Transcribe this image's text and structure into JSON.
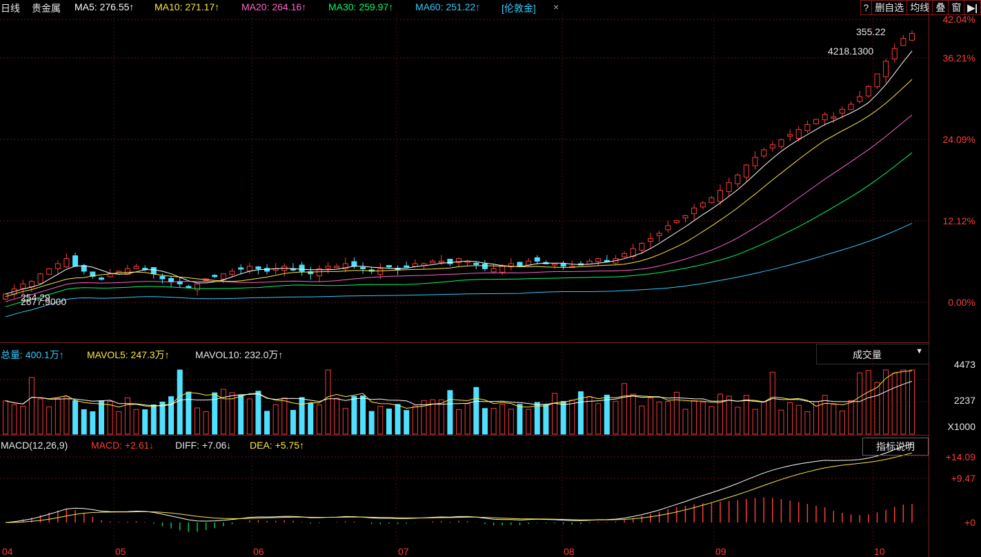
{
  "header": {
    "period": "日线",
    "name": "贵金属",
    "ma5": "MA5: 276.55↑",
    "ma10": "MA10: 271.17↑",
    "ma20": "MA20: 264.16↑",
    "ma30": "MA30: 259.97↑",
    "ma60": "MA60: 251.22↑",
    "overlay": "[伦敦金]",
    "close": "×"
  },
  "toolbar": [
    "?",
    "删自选",
    "均线",
    "叠",
    "窗"
  ],
  "toolbar_colors": {
    "border": "#8a1a1a"
  },
  "price_axis": [
    "42.04%",
    "36.21%",
    "24.09%",
    "12.12%",
    "0.00%"
  ],
  "annotations": {
    "high": "355.22",
    "overlay_value": "4218.1300",
    "low_a": "254.29",
    "low_b": "2677.9000"
  },
  "volume": {
    "total": "总量: 400.1万↑",
    "mavol5": "MAVOL5: 247.3万↑",
    "mavol10": "MAVOL10: 232.0万↑",
    "dropdown": "成交量",
    "axis": [
      "4473",
      "2237",
      "X1000"
    ]
  },
  "macd": {
    "title": "MACD(12,26,9)",
    "macd": "MACD: +2.61↓",
    "diff": "DIFF: +7.06↓",
    "dea": "DEA: +5.75↑",
    "button": "指标说明",
    "axis": [
      "+14.09",
      "+9.47",
      "+0"
    ]
  },
  "x_axis": [
    "04",
    "05",
    "06",
    "07",
    "08",
    "09",
    "10"
  ],
  "colors": {
    "up": "#ff3b3b",
    "down": "#50e0ff",
    "ma5": "#ffffff",
    "ma10": "#ffeb3b",
    "ma20": "#ff66cc",
    "ma30": "#00ff66",
    "ma60": "#33ccff"
  },
  "chart_data": {
    "type": "candlestick",
    "title": "贵金属",
    "y_axis_labels": [
      "42.04%",
      "36.21%",
      "24.09%",
      "12.12%",
      "0.00%"
    ],
    "close_series": [
      252,
      254,
      256,
      257,
      260,
      262,
      264,
      266,
      263,
      261,
      259,
      258,
      260,
      261,
      262,
      263,
      262,
      260,
      258,
      257,
      256,
      255,
      256,
      258,
      259,
      260,
      261,
      262,
      263,
      262,
      261,
      262,
      263,
      262,
      261,
      260,
      262,
      263,
      263,
      264,
      263,
      262,
      261,
      262,
      263,
      262,
      263,
      264,
      264,
      265,
      265,
      264,
      266,
      265,
      264,
      262,
      262,
      263,
      264,
      263,
      265,
      265,
      264,
      264,
      263,
      263,
      264,
      265,
      266,
      265,
      266,
      268,
      270,
      272,
      274,
      276,
      279,
      281,
      283,
      286,
      288,
      290,
      293,
      296,
      299,
      303,
      306,
      309,
      311,
      313,
      315,
      317,
      319,
      321,
      323,
      322,
      325,
      327,
      330,
      334,
      339,
      344,
      349,
      353,
      355
    ],
    "ylim": [
      240,
      360
    ]
  }
}
